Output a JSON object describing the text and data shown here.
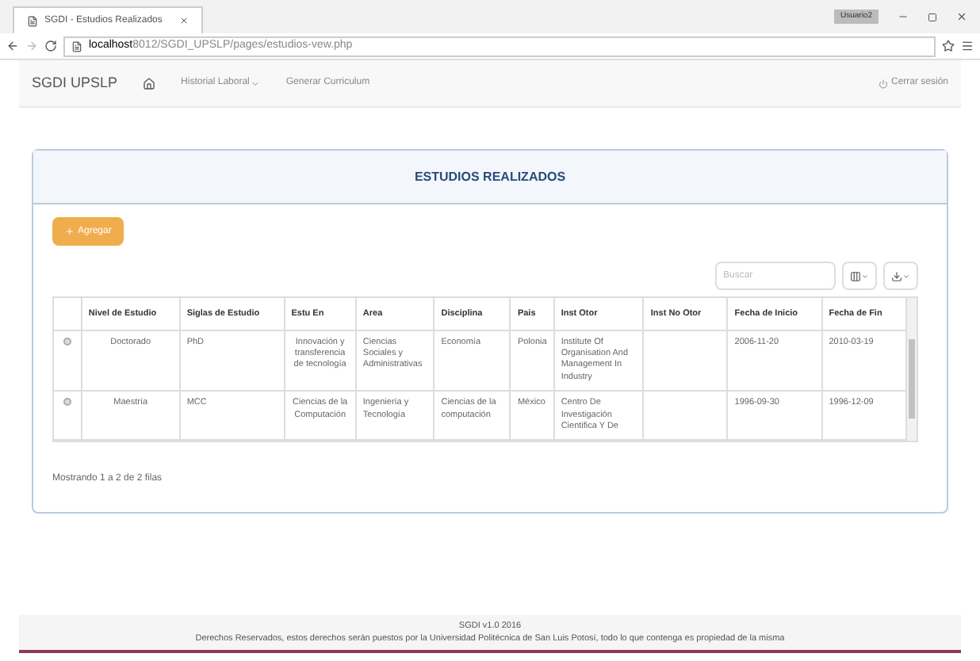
{
  "browser": {
    "tab_title": "SGDI - Estudios Realizados",
    "profile": "Usuario2",
    "url_host": "localhost",
    "url_path": "8012/SGDI_UPSLP/pages/estudios-vew.php"
  },
  "navbar": {
    "brand": "SGDI UPSLP",
    "items": [
      {
        "label": "Historial Laboral",
        "dropdown": true
      },
      {
        "label": "Generar Curriculum",
        "dropdown": false
      }
    ],
    "logout": "Cerrar sesión"
  },
  "panel": {
    "title": "ESTUDIOS REALIZADOS",
    "add_button": "Agregar",
    "search": {
      "placeholder": "Buscar"
    },
    "table": {
      "columns": [
        "Nivel de Estudio",
        "Siglas de Estudio",
        "Estu En",
        "Area",
        "Disciplina",
        "Pais",
        "Inst Otor",
        "Inst No Otor",
        "Fecha de Inicio",
        "Fecha de Fin"
      ],
      "rows": [
        {
          "selected": false,
          "cells": [
            "Doctorado",
            "PhD",
            "Innovación y transferencia de tecnología",
            "Ciencias Sociales y Administrativas",
            "Economía",
            "Polonia",
            "Institute Of Organisation And Management In Industry",
            "",
            "2006-11-20",
            "2010-03-19"
          ]
        },
        {
          "selected": false,
          "cells": [
            "Maestría",
            "MCC",
            "Ciencias de la Computación",
            "Ingeniería y Tecnología",
            "Ciencias de la computación",
            "México",
            "Centro De Investigación Cientifica Y De",
            "",
            "1996-09-30",
            "1996-12-09"
          ]
        }
      ]
    },
    "pagination_info": "Mostrando 1 a 2 de 2 filas"
  },
  "footer": {
    "version": "SGDI v1.0 2016",
    "rights": "Derechos Reservados, estos derechos serán puestos por la Universidad Politécnica de San Luis Potosí, todo lo que contenga es propiedad de la misma"
  }
}
